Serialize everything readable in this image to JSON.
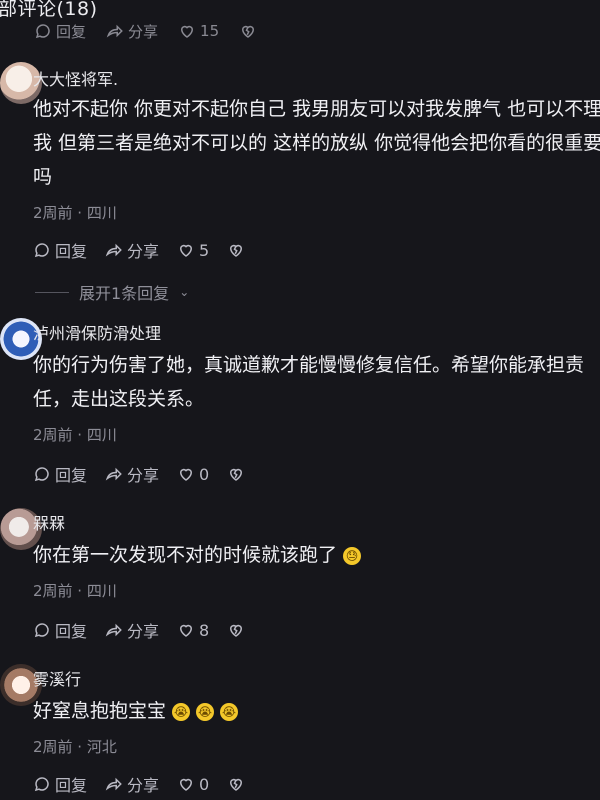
{
  "header": {
    "title": "部评论(18)",
    "actions": {
      "reply": "回复",
      "share": "分享",
      "likes": "15"
    }
  },
  "comments": [
    {
      "username": "大大怪将军.",
      "text": "他对不起你 你更对不起你自己 我男朋友可以对我发脾气 也可以不理我 但第三者是绝对不可以的 这样的放纵 你觉得他会把你看的很重要吗",
      "meta": "2周前 · 四川",
      "reply_label": "回复",
      "share_label": "分享",
      "likes": "5",
      "expand_replies": "展开1条回复"
    },
    {
      "username": "泸州滑保防滑处理",
      "text": "你的行为伤害了她，真诚道歉才能慢慢修复信任。希望你能承担责任，走出这段关系。",
      "meta": "2周前 · 四川",
      "reply_label": "回复",
      "share_label": "分享",
      "likes": "0"
    },
    {
      "username": "槑槑",
      "text": "你在第一次发现不对的时候就该跑了",
      "meta": "2周前 · 四川",
      "reply_label": "回复",
      "share_label": "分享",
      "likes": "8"
    },
    {
      "username": "雾溪行",
      "text": "好窒息抱抱宝宝",
      "meta": "2周前 · 河北",
      "reply_label": "回复",
      "share_label": "分享",
      "likes": "0"
    }
  ],
  "icons": {
    "reply": "comment-bubble-icon",
    "share": "share-arrow-icon",
    "like": "heart-icon",
    "dislike": "broken-heart-icon",
    "emoji": "sweat-face-emoji"
  },
  "colors": {
    "background": "#16161b",
    "text": "#f0f0f4",
    "meta": "#8c8c96",
    "action": "#b9b9c3"
  }
}
